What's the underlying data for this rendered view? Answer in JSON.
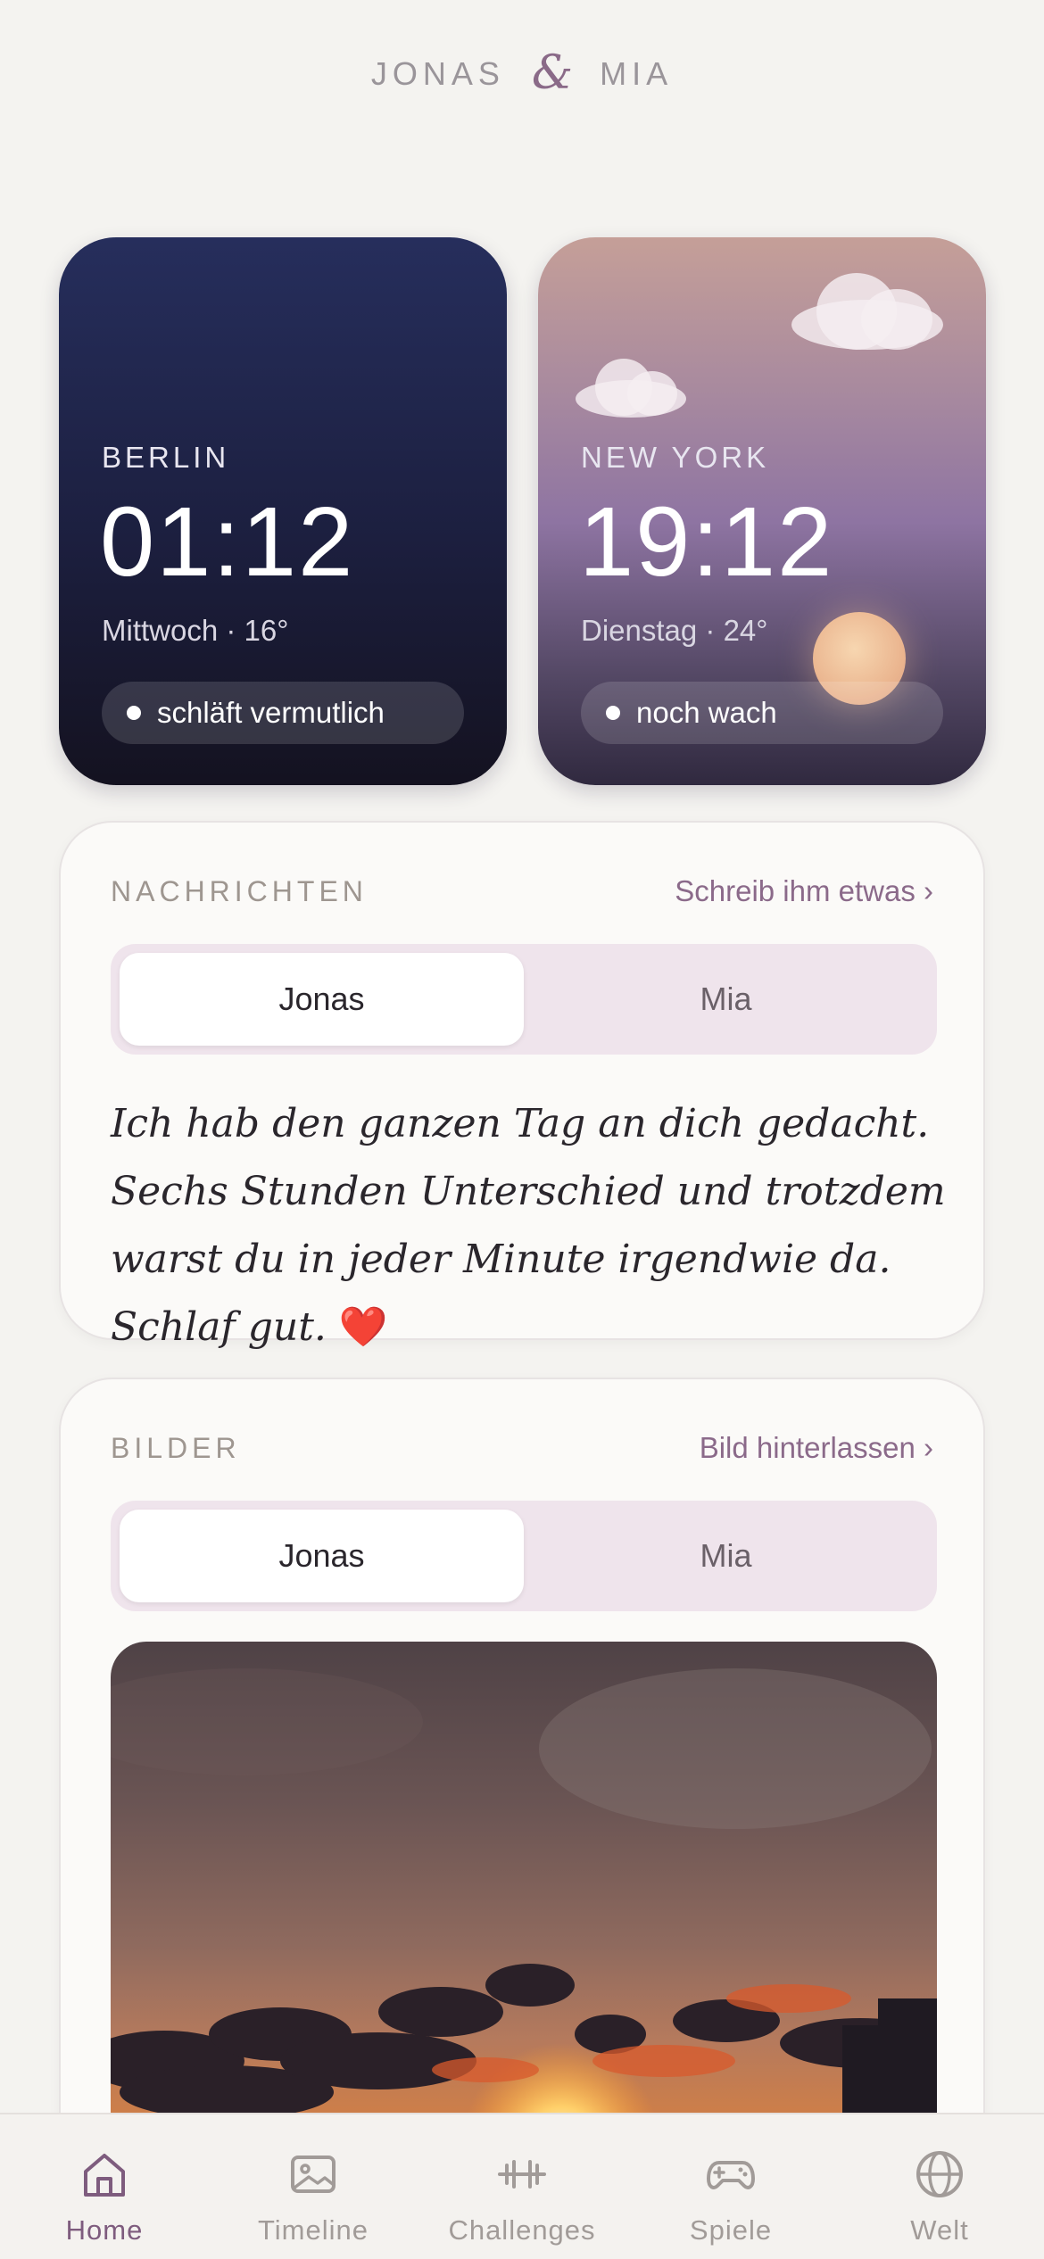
{
  "header": {
    "name_left": "JONAS",
    "ampersand": "&",
    "name_right": "MIA"
  },
  "clocks": [
    {
      "city": "BERLIN",
      "time": "01:12",
      "meta": "Mittwoch · 16°",
      "status": "schläft vermutlich"
    },
    {
      "city": "NEW YORK",
      "time": "19:12",
      "meta": "Dienstag · 24°",
      "status": "noch wach"
    }
  ],
  "messages": {
    "title": "NACHRICHTEN",
    "link": "Schreib ihm etwas ›",
    "tabs": [
      "Jonas",
      "Mia"
    ],
    "active_tab": "Jonas",
    "text": "Ich hab den ganzen Tag an dich gedacht. Sechs Stunden Unterschied und trotzdem warst du in jeder Minute irgendwie da. Schlaf gut.",
    "emoji": "❤️"
  },
  "pictures": {
    "title": "BILDER",
    "link": "Bild hinterlassen ›",
    "tabs": [
      "Jonas",
      "Mia"
    ],
    "active_tab": "Jonas"
  },
  "nav": {
    "items": [
      {
        "label": "Home",
        "icon": "home-icon",
        "active": true
      },
      {
        "label": "Timeline",
        "icon": "image-icon",
        "active": false
      },
      {
        "label": "Challenges",
        "icon": "dumbbell-icon",
        "active": false
      },
      {
        "label": "Spiele",
        "icon": "gamepad-icon",
        "active": false
      },
      {
        "label": "Welt",
        "icon": "globe-icon",
        "active": false
      }
    ],
    "active_color": "#7e5c7e",
    "inactive_color": "#a19b98"
  },
  "colors": {
    "accent": "#8b6a8a",
    "background": "#f4f3f0",
    "segment_bg": "#efe4ec"
  }
}
